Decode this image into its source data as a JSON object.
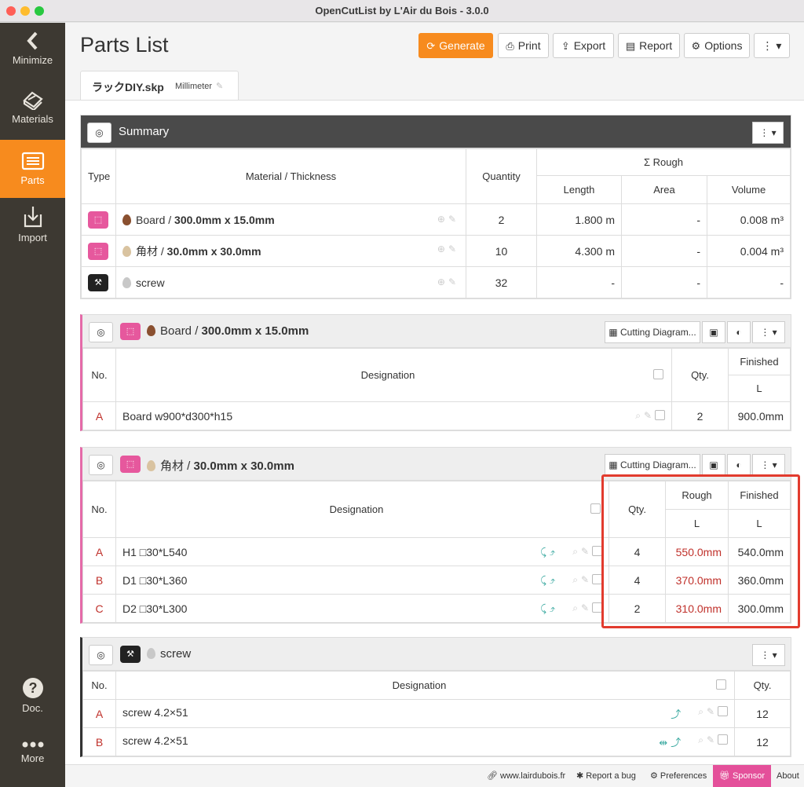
{
  "window": {
    "title": "OpenCutList by L'Air du Bois - 3.0.0"
  },
  "sidebar": {
    "items": [
      {
        "label": "Minimize",
        "icon": "chevron-left-icon"
      },
      {
        "label": "Materials",
        "icon": "materials-icon"
      },
      {
        "label": "Parts",
        "icon": "parts-list-icon",
        "active": true
      },
      {
        "label": "Import",
        "icon": "import-icon"
      }
    ],
    "bottom": [
      {
        "label": "Doc.",
        "icon": "help-circle-icon"
      },
      {
        "label": "More",
        "icon": "more-dots-icon"
      }
    ]
  },
  "header": {
    "title": "Parts List",
    "buttons": {
      "generate": "Generate",
      "print": "Print",
      "export": "Export",
      "report": "Report",
      "options": "Options"
    }
  },
  "file_tab": {
    "name": "ラックDIY.skp",
    "unit": "Millimeter"
  },
  "summary": {
    "title": "Summary",
    "headers": {
      "type": "Type",
      "material": "Material / Thickness",
      "quantity": "Quantity",
      "rough": "Σ Rough",
      "length": "Length",
      "area": "Area",
      "volume": "Volume"
    },
    "rows": [
      {
        "material": "Board",
        "thickness": "300.0mm x 15.0mm",
        "quantity": "2",
        "length": "1.800 m",
        "area": "-",
        "volume": "0.008 m³"
      },
      {
        "material": "角材",
        "thickness": "30.0mm x 30.0mm",
        "quantity": "10",
        "length": "4.300 m",
        "area": "-",
        "volume": "0.004 m³"
      },
      {
        "material": "screw",
        "thickness": "",
        "quantity": "32",
        "length": "-",
        "area": "-",
        "volume": "-"
      }
    ]
  },
  "groups": {
    "board": {
      "material": "Board",
      "thickness": "300.0mm x 15.0mm",
      "cutting_button": "Cutting Diagram...",
      "headers": {
        "no": "No.",
        "designation": "Designation",
        "qty": "Qty.",
        "finished": "Finished",
        "l": "L"
      },
      "rows": [
        {
          "no": "A",
          "designation": "Board w900*d300*h15",
          "qty": "2",
          "finished": "900.0mm"
        }
      ]
    },
    "kakuzai": {
      "material": "角材",
      "thickness": "30.0mm x 30.0mm",
      "cutting_button": "Cutting Diagram...",
      "headers": {
        "no": "No.",
        "designation": "Designation",
        "qty": "Qty.",
        "rough": "Rough",
        "finished": "Finished",
        "l": "L"
      },
      "rows": [
        {
          "no": "A",
          "designation": "H1 □30*L540",
          "qty": "4",
          "rough": "550.0mm",
          "finished": "540.0mm"
        },
        {
          "no": "B",
          "designation": "D1 □30*L360",
          "qty": "4",
          "rough": "370.0mm",
          "finished": "360.0mm"
        },
        {
          "no": "C",
          "designation": "D2 □30*L300",
          "qty": "2",
          "rough": "310.0mm",
          "finished": "300.0mm"
        }
      ]
    },
    "screw": {
      "material": "screw",
      "headers": {
        "no": "No.",
        "designation": "Designation",
        "qty": "Qty."
      },
      "rows": [
        {
          "no": "A",
          "designation": "screw 4.2×51",
          "qty": "12"
        },
        {
          "no": "B",
          "designation": "screw 4.2×51",
          "qty": "12"
        }
      ]
    }
  },
  "footer": {
    "website": "www.lairdubois.fr",
    "report_bug": "Report a bug",
    "preferences": "Preferences",
    "sponsor": "Sponsor",
    "about": "About"
  },
  "colors": {
    "accent": "#f78b1e",
    "sidebar": "#3d3932",
    "board_icon": "#e6589d",
    "rough_value": "#c0312b",
    "highlight": "#e23b2e"
  }
}
